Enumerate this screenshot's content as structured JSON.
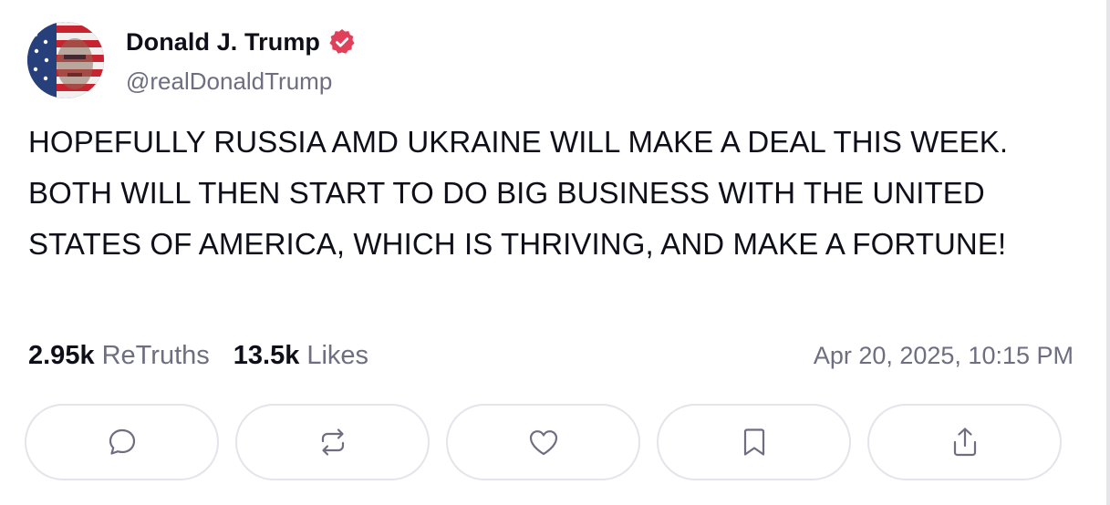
{
  "author": {
    "display_name": "Donald J. Trump",
    "handle": "@realDonaldTrump",
    "verified_color": "#e0405a",
    "avatar_icon": "avatar-flag-portrait"
  },
  "post": {
    "text": "HOPEFULLY RUSSIA AMD UKRAINE WILL MAKE A DEAL THIS WEEK. BOTH WILL THEN START TO DO BIG BUSINESS WITH THE UNITED STATES OF AMERICA, WHICH IS THRIVING, AND MAKE A FORTUNE!"
  },
  "stats": {
    "retruths_count": "2.95k",
    "retruths_label": "ReTruths",
    "likes_count": "13.5k",
    "likes_label": "Likes"
  },
  "timestamp": "Apr 20, 2025, 10:15 PM",
  "actions": [
    {
      "name": "reply",
      "icon": "comment-icon"
    },
    {
      "name": "retruth",
      "icon": "repost-icon"
    },
    {
      "name": "like",
      "icon": "heart-icon"
    },
    {
      "name": "bookmark",
      "icon": "bookmark-icon"
    },
    {
      "name": "share",
      "icon": "share-icon"
    }
  ],
  "colors": {
    "text": "#0f0f1a",
    "muted": "#6e6e80",
    "border": "#e4e4ea"
  }
}
